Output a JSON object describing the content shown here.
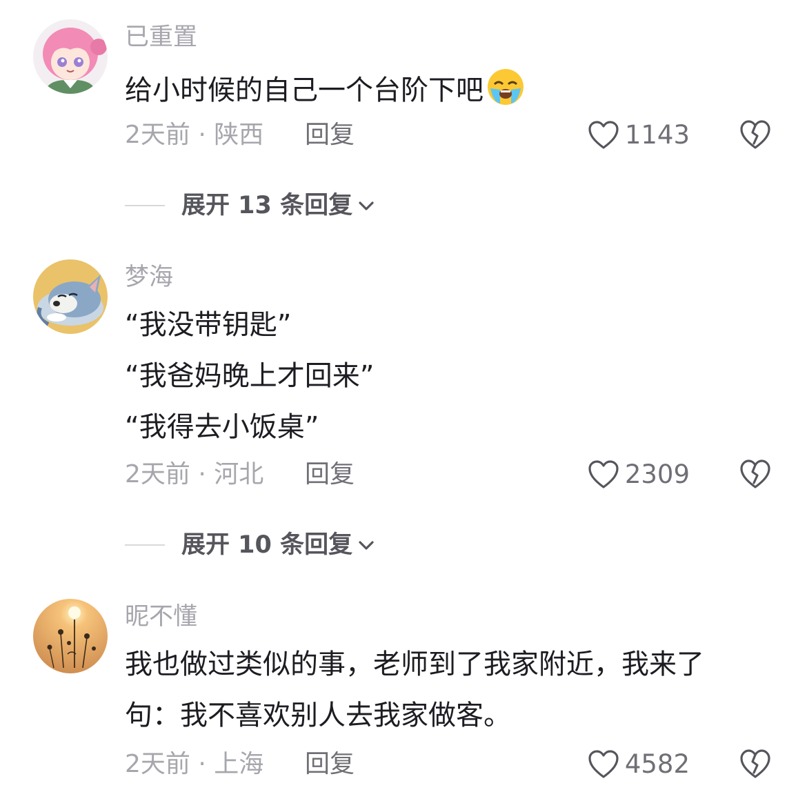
{
  "comments": [
    {
      "username": "已重置",
      "lines": [
        "给小时候的自己一个台阶下吧"
      ],
      "emoji": "loudly-crying-face",
      "meta": "2天前 · 陕西",
      "reply_label": "回复",
      "likes": "1143",
      "expand_label": "展开 13 条回复"
    },
    {
      "username": "梦海",
      "lines": [
        "“我没带钥匙”",
        "“我爸妈晚上才回来”",
        "“我得去小饭桌”"
      ],
      "meta": "2天前 · 河北",
      "reply_label": "回复",
      "likes": "2309",
      "expand_label": "展开 10 条回复"
    },
    {
      "username": "昵不懂",
      "lines": [
        "我也做过类似的事，老师到了我家附近，我来了",
        "句：我不喜欢别人去我家做客。"
      ],
      "meta": "2天前 · 上海",
      "reply_label": "回复",
      "likes": "4582"
    }
  ],
  "icons": {
    "like": "heart-outline-icon",
    "dislike": "broken-heart-icon",
    "expand": "chevron-down-icon"
  },
  "colors": {
    "username": "#a6a6ad",
    "text": "#1c1c22",
    "meta": "#a6a6ad",
    "reply": "#6f6f76",
    "expand": "#55555c"
  }
}
